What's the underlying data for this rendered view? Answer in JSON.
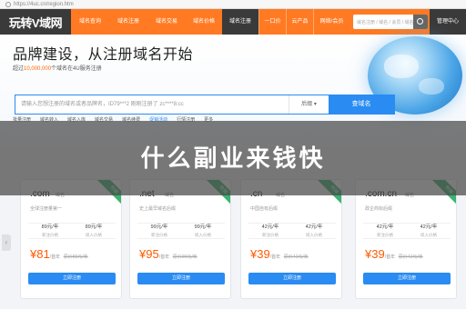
{
  "browser": {
    "url": "https://4uc.cn/region.htm"
  },
  "nav": {
    "logo": "玩转V域网",
    "items": [
      {
        "label": "域名查询",
        "active": false
      },
      {
        "label": "域名注册",
        "active": false
      },
      {
        "label": "域名交易",
        "active": false
      },
      {
        "label": "域名价格",
        "active": false
      },
      {
        "label": "域名注册",
        "active": true
      },
      {
        "label": "一口价",
        "active": false
      },
      {
        "label": "云产品",
        "active": false
      },
      {
        "label": "网络/会员",
        "active": false
      }
    ],
    "search_placeholder": "域名注册 / 域名 / 会员 / 域名价格",
    "right_label": "管理中心"
  },
  "hero": {
    "title": "品牌建设，从注册域名开始",
    "subtitle_prefix": "超过",
    "subtitle_count": "10,000,000",
    "subtitle_suffix": "个域名在4U服务注册",
    "search_placeholder": "请输入您想注册的域名或者品牌名，ID79***2 刚刚注册了 zc****8.cc",
    "select_value": "后缀",
    "search_button": "查域名",
    "links": [
      {
        "label": "批量注册",
        "hot": false
      },
      {
        "label": "域名转入",
        "hot": false
      },
      {
        "label": "域名入库",
        "hot": false
      },
      {
        "label": "域名交易",
        "hot": false
      },
      {
        "label": "域名续费",
        "hot": false
      },
      {
        "label": "促销活动",
        "hot": true
      },
      {
        "label": "行情注册",
        "hot": false
      },
      {
        "label": "更多",
        "hot": false
      }
    ]
  },
  "overlay": {
    "text": "什么副业来钱快"
  },
  "cards": [
    {
      "tld": ".com",
      "desc": "域名",
      "ribbon": "热销",
      "feature": "全球注册量第一",
      "price1": "89元/年",
      "label1": "新注价格",
      "price2": "89元/年",
      "label2": "续入价格",
      "big_price": "¥81",
      "unit": "/首年",
      "orig": "原价89元/年",
      "button": "立即注册"
    },
    {
      "tld": ".net",
      "desc": "域名",
      "ribbon": "热销",
      "feature": "史上最早域名后缀",
      "price1": "99元/年",
      "label1": "新注价格",
      "price2": "99元/年",
      "label2": "续入价格",
      "big_price": "¥95",
      "unit": "/首年",
      "orig": "原价99元/年",
      "button": "立即注册"
    },
    {
      "tld": ".cn",
      "desc": "域名",
      "ribbon": "热销",
      "feature": "中国自有后缀",
      "price1": "42元/年",
      "label1": "新注价格",
      "price2": "42元/年",
      "label2": "续入价格",
      "big_price": "¥39",
      "unit": "/首年",
      "orig": "原价42元/年",
      "button": "立即注册"
    },
    {
      "tld": ".com.cn",
      "desc": "域名",
      "ribbon": "热销",
      "feature": "政企商标后缀",
      "price1": "42元/年",
      "label1": "新注价格",
      "price2": "42元/年",
      "label2": "续入价格",
      "big_price": "¥39",
      "unit": "/首年",
      "orig": "原价42元/年",
      "button": "立即注册"
    }
  ],
  "colors": {
    "nav": "#ff7a22",
    "accent": "#2a8bf2",
    "price": "#ff5a00",
    "ribbon": "#3bb36f"
  }
}
